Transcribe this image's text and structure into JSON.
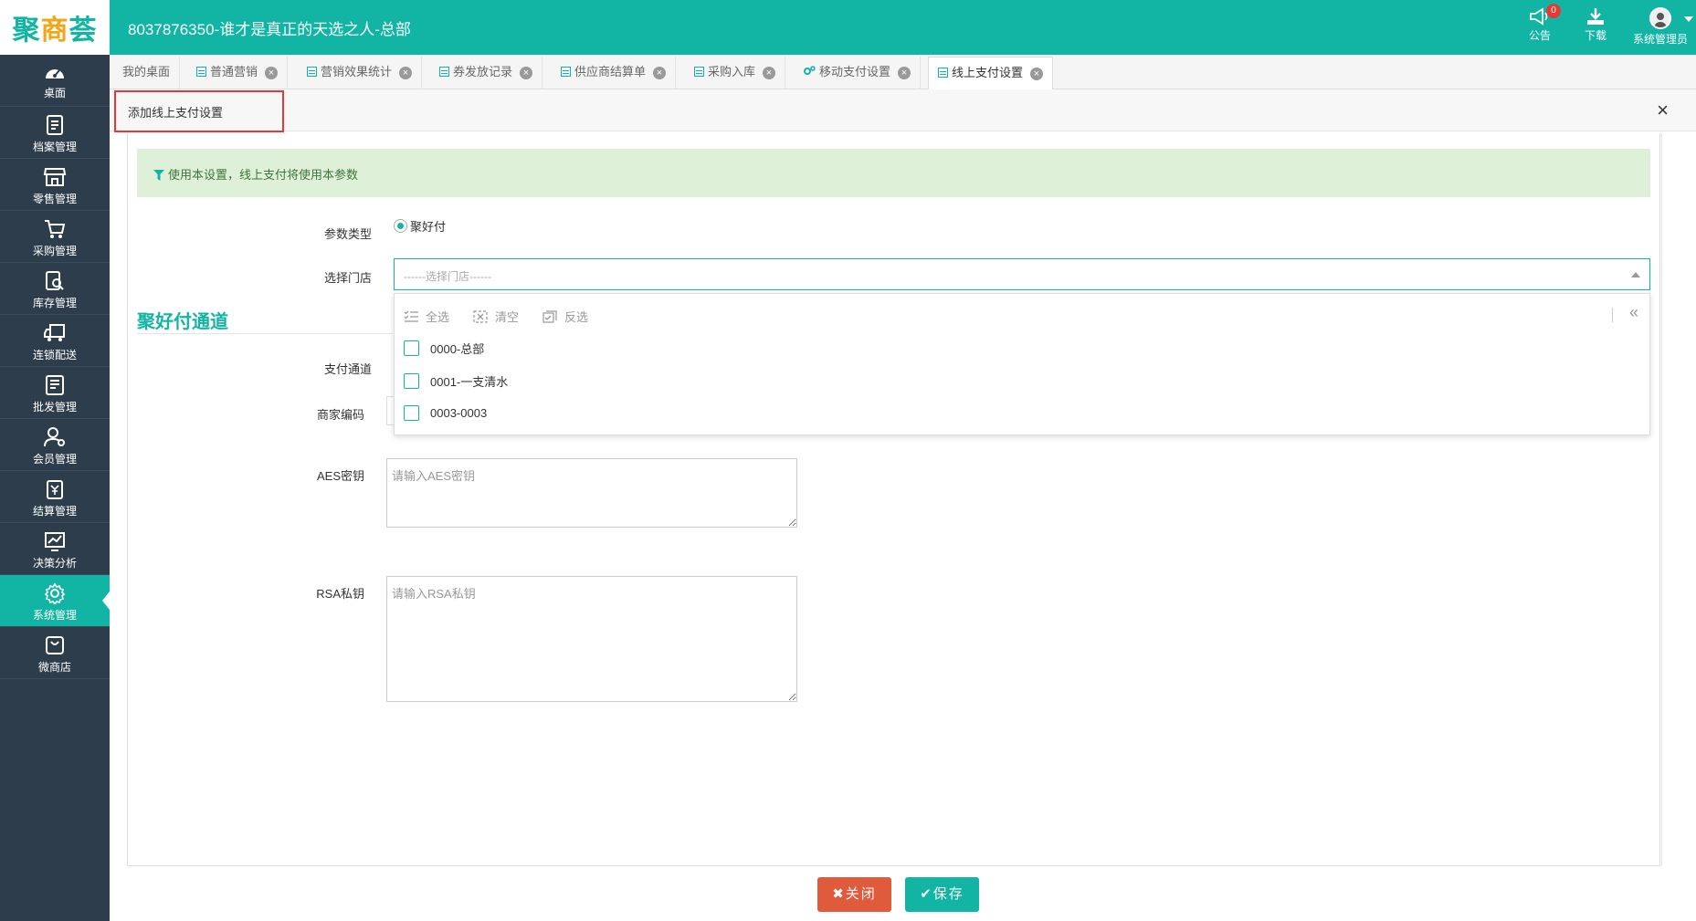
{
  "header": {
    "logo": "聚商荟",
    "title": "8037876350-谁才是真正的天选之人-总部",
    "notice_label": "公告",
    "notice_count": "0",
    "download_label": "下载",
    "user_label": "系统管理员"
  },
  "sidebar": {
    "items": [
      {
        "label": "桌面",
        "icon": "dashboard-icon"
      },
      {
        "label": "档案管理",
        "icon": "archive-icon"
      },
      {
        "label": "零售管理",
        "icon": "store-icon"
      },
      {
        "label": "采购管理",
        "icon": "cart-icon"
      },
      {
        "label": "库存管理",
        "icon": "inventory-icon"
      },
      {
        "label": "连锁配送",
        "icon": "truck-icon"
      },
      {
        "label": "批发管理",
        "icon": "wholesale-icon"
      },
      {
        "label": "会员管理",
        "icon": "member-icon"
      },
      {
        "label": "结算管理",
        "icon": "settlement-icon"
      },
      {
        "label": "决策分析",
        "icon": "chart-icon"
      },
      {
        "label": "系统管理",
        "icon": "gear-icon"
      },
      {
        "label": "微商店",
        "icon": "shop-bag-icon"
      }
    ],
    "active_index": 10
  },
  "tabs": [
    {
      "label": "我的桌面"
    },
    {
      "label": "普通营销"
    },
    {
      "label": "营销效果统计"
    },
    {
      "label": "券发放记录"
    },
    {
      "label": "供应商结算单"
    },
    {
      "label": "采购入库"
    },
    {
      "label": "移动支付设置"
    },
    {
      "label": "线上支付设置"
    }
  ],
  "panel": {
    "title": "添加线上支付设置",
    "close_symbol": "×"
  },
  "info": {
    "text": "使用本设置，线上支付将使用本参数"
  },
  "form": {
    "param_type_label": "参数类型",
    "param_type_value": "聚好付",
    "store_label": "选择门店",
    "store_placeholder": "------选择门店------",
    "section_title": "聚好付通道",
    "channel_label": "支付通道",
    "merchant_label": "商家编码",
    "aes_label": "AES密钥",
    "aes_placeholder": "请输入AES密钥",
    "rsa_label": "RSA私钥",
    "rsa_placeholder": "请输入RSA私钥"
  },
  "dropdown": {
    "select_all": "全选",
    "clear": "清空",
    "invert": "反选",
    "collapse": "«",
    "options": [
      "0000-总部",
      "0001-一支清水",
      "0003-0003"
    ]
  },
  "buttons": {
    "close": "✖关闭",
    "save": "✔保存"
  },
  "colors": {
    "brand": "#12b5a4",
    "sidebar_bg": "#2e3d4b",
    "danger": "#e05a3c",
    "highlight_box": "#e53935",
    "info_bg": "#dff0d8"
  }
}
